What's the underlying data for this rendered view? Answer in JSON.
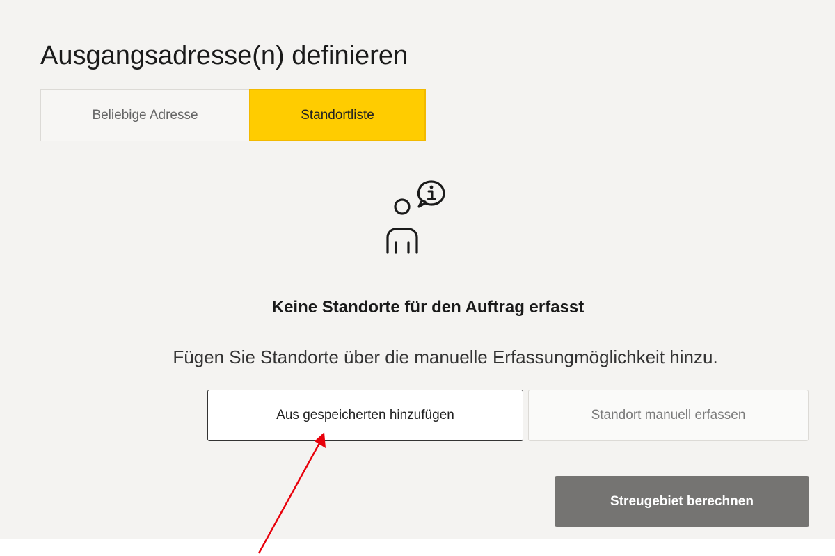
{
  "header": {
    "title": "Ausgangsadresse(n) definieren"
  },
  "segmented_control": {
    "options": [
      {
        "label": "Beliebige Adresse",
        "selected": false
      },
      {
        "label": "Standortliste",
        "selected": true
      }
    ]
  },
  "empty_state": {
    "icon": "person-info-speech-icon",
    "headline": "Keine Standorte für den Auftrag erfasst",
    "description": "Fügen Sie Standorte über die manuelle Erfassungmöglichkeit hinzu."
  },
  "actions": {
    "add_from_saved_label": "Aus gespeicherten hinzufügen",
    "manual_entry_label": "Standort manuell erfassen",
    "calculate_label": "Streugebiet berechnen"
  },
  "annotation": {
    "arrow_color": "#e8000b",
    "points_to": "add-from-saved-button"
  },
  "colors": {
    "accent": "#ffcc00",
    "panel_background": "#f4f3f1",
    "primary_disabled": "#757472"
  }
}
